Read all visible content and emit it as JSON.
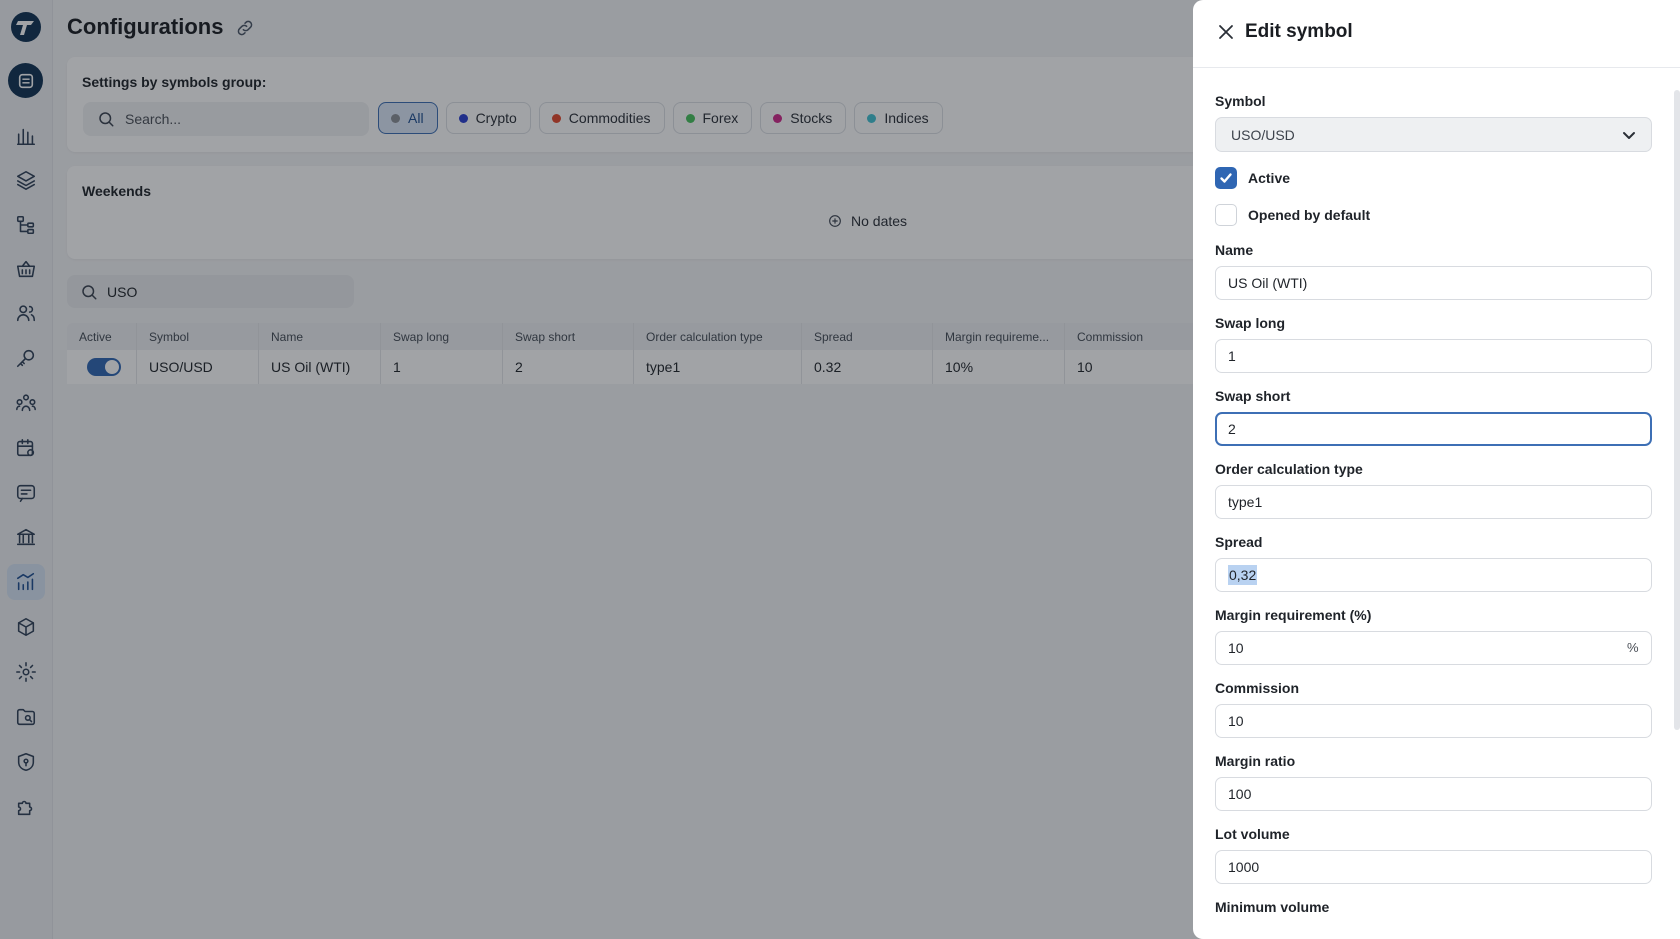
{
  "page": {
    "title": "Configurations"
  },
  "sidebar": {
    "items": [
      {
        "name": "bar-chart-icon"
      },
      {
        "name": "layers-icon"
      },
      {
        "name": "hierarchy-icon"
      },
      {
        "name": "basket-icon"
      },
      {
        "name": "users-icon"
      },
      {
        "name": "key-icon"
      },
      {
        "name": "group-icon"
      },
      {
        "name": "calendar-settings-icon"
      },
      {
        "name": "message-icon"
      },
      {
        "name": "bank-icon"
      },
      {
        "name": "analytics-icon",
        "active": true
      },
      {
        "name": "box-icon"
      },
      {
        "name": "gear-icon"
      },
      {
        "name": "folder-search-icon"
      },
      {
        "name": "shield-icon"
      },
      {
        "name": "puzzle-icon"
      }
    ]
  },
  "groups": {
    "title": "Settings by symbols group:",
    "search_placeholder": "Search...",
    "chips": [
      {
        "label": "All",
        "color": "#8a8f96",
        "selected": true
      },
      {
        "label": "Crypto",
        "color": "#2a3fd1"
      },
      {
        "label": "Commodities",
        "color": "#e4492c"
      },
      {
        "label": "Forex",
        "color": "#46c25c"
      },
      {
        "label": "Stocks",
        "color": "#d0288a"
      },
      {
        "label": "Indices",
        "color": "#41c1d3"
      }
    ]
  },
  "weekends": {
    "title": "Weekends",
    "empty_text": "No dates"
  },
  "table": {
    "search_value": "USO",
    "headers": [
      "Active",
      "Symbol",
      "Name",
      "Swap long",
      "Swap short",
      "Order calculation type",
      "Spread",
      "Margin requireme...",
      "Commission"
    ],
    "rows": [
      {
        "symbol": "USO/USD",
        "name": "US Oil (WTI)",
        "swap_long": "1",
        "swap_short": "2",
        "order_type": "type1",
        "spread": "0.32",
        "margin": "10%",
        "commission": "10"
      }
    ]
  },
  "drawer": {
    "title": "Edit symbol",
    "symbol_label": "Symbol",
    "symbol_value": "USO/USD",
    "active_label": "Active",
    "opened_label": "Opened by default",
    "name_label": "Name",
    "name_value": "US Oil (WTI)",
    "swap_long_label": "Swap long",
    "swap_long_value": "1",
    "swap_short_label": "Swap short",
    "swap_short_value": "2",
    "order_type_label": "Order calculation type",
    "order_type_value": "type1",
    "spread_label": "Spread",
    "spread_value": "0,32",
    "margin_label": "Margin requirement (%)",
    "margin_value": "10",
    "margin_suffix": "%",
    "commission_label": "Commission",
    "commission_value": "10",
    "margin_ratio_label": "Margin ratio",
    "margin_ratio_value": "100",
    "lot_volume_label": "Lot volume",
    "lot_volume_value": "1000",
    "min_volume_label": "Minimum volume"
  },
  "colors": {
    "accent": "#2f66b3",
    "brand_dark": "#0f3152"
  }
}
